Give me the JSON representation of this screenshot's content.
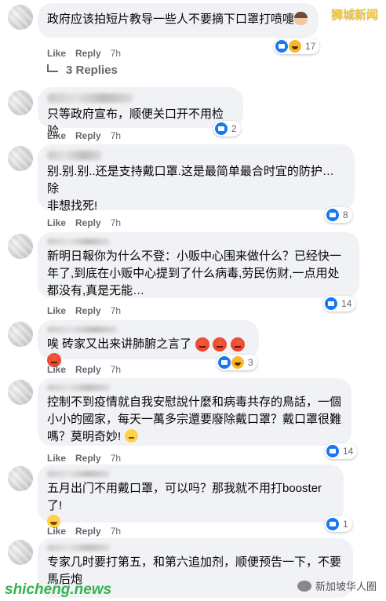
{
  "watermark": {
    "top_right": "狮城新闻",
    "bottom_left": "shicheng.news",
    "bottom_right": "新加坡华人圈"
  },
  "comments": [
    {
      "text": "政府应该拍短片教导一些人不要摘下口罩打喷嚏",
      "has_name": false,
      "inline_emoji": "woman",
      "like": "Like",
      "reply": "Reply",
      "time": "7h",
      "reactions": [
        "like",
        "haha"
      ],
      "count": "17"
    },
    {
      "text": "只等政府宣布，顺便关口开不用检验",
      "has_name": true,
      "like": "Like",
      "reply": "Reply",
      "time": "7h",
      "reactions": [
        "like"
      ],
      "count": "2"
    },
    {
      "text": "别.别.别..还是支持戴口罩.这是最简单最合时宜的防护…除\n非想找死!",
      "has_name": true,
      "like": "Like",
      "reply": "Reply",
      "time": "7h",
      "reactions": [
        "like"
      ],
      "count": "8"
    },
    {
      "text": "新明日報你为什么不登：小贩中心围来做什么？已经快一\n年了,到底在小贩中心提到了什么病毒,劳民伤财,一点用处\n都没有,真是无能…",
      "has_name": true,
      "like": "Like",
      "reply": "Reply",
      "time": "7h",
      "reactions": [
        "like"
      ],
      "count": "14"
    },
    {
      "text": "唉 砖家又出来讲肺腑之言了",
      "has_name": true,
      "inline_emoji": "angry4",
      "like": "Like",
      "reply": "Reply",
      "time": "7h",
      "reactions": [
        "like",
        "haha"
      ],
      "count": "3"
    },
    {
      "text": "控制不到疫情就自我安慰說什麼和病毒共存的鳥話，一個\n小小的國家，每天一萬多宗還要廢除戴口罩？戴口罩很難\n嗎？莫明奇妙!",
      "has_name": true,
      "inline_emoji": "sweat",
      "like": "Like",
      "reply": "Reply",
      "time": "7h",
      "reactions": [
        "like"
      ],
      "count": "14"
    },
    {
      "text": "五月出门不用戴口罩，可以吗？那我就不用打booster 了!",
      "has_name": true,
      "inline_emoji": "grin",
      "like": "Like",
      "reply": "Reply",
      "time": "7h",
      "reactions": [
        "like"
      ],
      "count": "1"
    },
    {
      "text": "专家几时要打第五，和第六追加剂，顺便预告一下，不要\n馬后炮",
      "has_name": true,
      "like": "",
      "reply": "",
      "time": "",
      "reactions": [],
      "count": ""
    }
  ],
  "replies_link": "3 Replies"
}
